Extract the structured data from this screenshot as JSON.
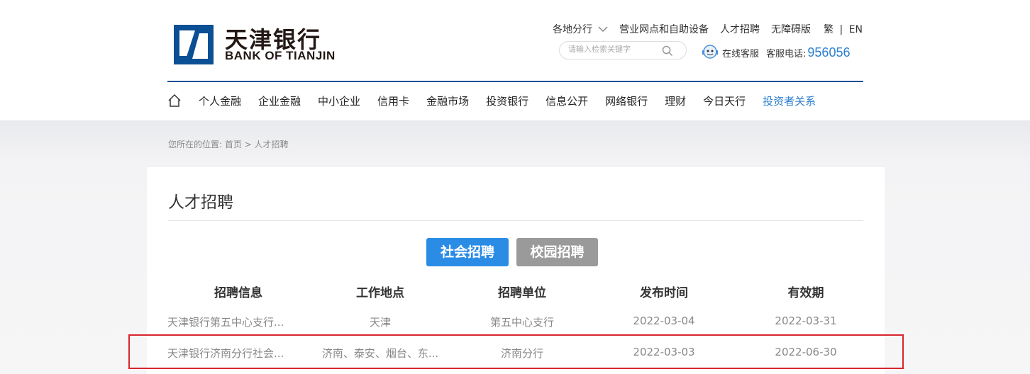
{
  "header": {
    "logo_cn": "天津银行",
    "logo_en": "BANK OF TIANJIN",
    "links": {
      "region": "各地分行",
      "outlets": "营业网点和自助设备",
      "careers": "人才招聘",
      "accessible": "无障碍版",
      "lang_trad": "繁",
      "lang_sep": "|",
      "lang_en": "EN"
    },
    "search_placeholder": "请输入检索关键字",
    "online_service": "在线客服",
    "hotline_label": "客服电话:",
    "hotline_number": "956056"
  },
  "nav": {
    "items": [
      "个人金融",
      "企业金融",
      "中小企业",
      "信用卡",
      "金融市场",
      "投资银行",
      "信息公开",
      "网络银行",
      "理财",
      "今日天行",
      "投资者关系"
    ]
  },
  "breadcrumb": "您所在的位置: 首页 > 人才招聘",
  "page": {
    "title": "人才招聘",
    "tabs": {
      "social": "社会招聘",
      "campus": "校园招聘"
    },
    "table": {
      "headers": [
        "招聘信息",
        "工作地点",
        "招聘单位",
        "发布时间",
        "有效期"
      ],
      "rows": [
        [
          "天津银行第五中心支行...",
          "天津",
          "第五中心支行",
          "2022-03-04",
          "2022-03-31"
        ],
        [
          "天津银行济南分行社会...",
          "济南、泰安、烟台、东...",
          "济南分行",
          "2022-03-03",
          "2022-06-30"
        ]
      ]
    }
  },
  "colors": {
    "brand_blue": "#0b4f95",
    "accent_blue": "#2b8ce6",
    "highlight_red": "#d9252d"
  }
}
